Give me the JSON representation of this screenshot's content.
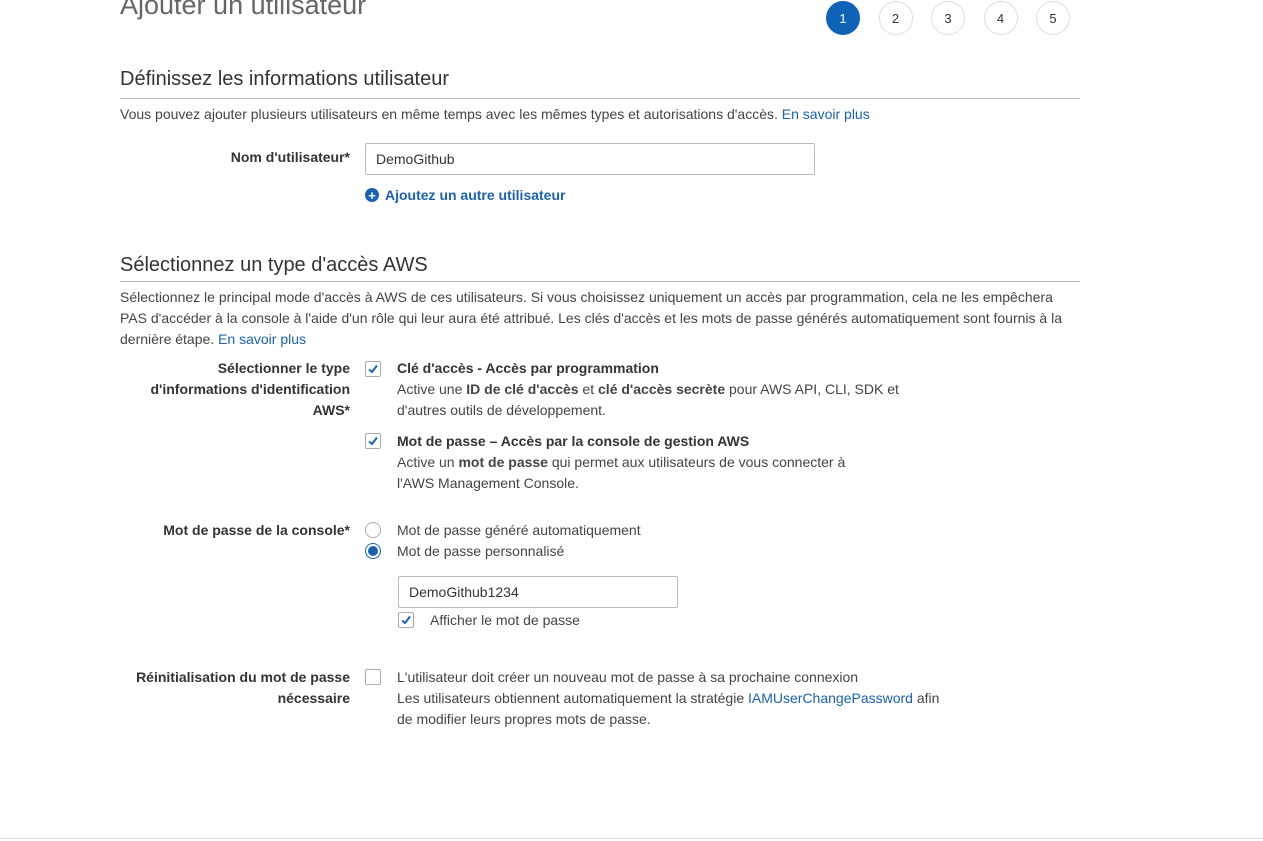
{
  "page": {
    "title": "Ajouter un utilisateur",
    "steps": [
      "1",
      "2",
      "3",
      "4",
      "5"
    ],
    "active_step": "1"
  },
  "user_info": {
    "heading": "Définissez les informations utilisateur",
    "description": "Vous pouvez ajouter plusieurs utilisateurs en même temps avec les mêmes types et autorisations d'accès.",
    "learn_more": "En savoir plus",
    "username_label": "Nom d'utilisateur*",
    "username_value": "DemoGithub",
    "add_user_link": "Ajoutez un autre utilisateur"
  },
  "access_type": {
    "heading": "Sélectionnez un type d'accès AWS",
    "description": "Sélectionnez le principal mode d'accès à AWS de ces utilisateurs. Si vous choisissez uniquement un accès par programmation, cela ne les empêchera PAS d'accéder à la console à l'aide d'un rôle qui leur aura été attribué. Les clés d'accès et les mots de passe générés automatiquement sont fournis à la dernière étape.",
    "learn_more": "En savoir plus",
    "select_label": "Sélectionner le type d'informations d'identification AWS*",
    "options": [
      {
        "title": "Clé d'accès - Accès par programmation",
        "text_pre": "Active une ",
        "bold1": "ID de clé d'accès",
        "text_mid": " et ",
        "bold2": "clé d'accès secrète",
        "text_post": " pour AWS API, CLI, SDK et d'autres outils de développement.",
        "checked": true
      },
      {
        "title": "Mot de passe – Accès par la console de gestion AWS",
        "text_pre": "Active un ",
        "bold1": "mot de passe",
        "text_post": " qui permet aux utilisateurs de vous connecter à l'AWS Management Console.",
        "checked": true
      }
    ]
  },
  "console_password": {
    "label": "Mot de passe de la console*",
    "options": [
      {
        "label": "Mot de passe généré automatiquement",
        "selected": false
      },
      {
        "label": "Mot de passe personnalisé",
        "selected": true
      }
    ],
    "password_value": "DemoGithub1234",
    "show_password_label": "Afficher le mot de passe",
    "show_password_checked": true
  },
  "password_reset": {
    "label": "Réinitialisation du mot de passe nécessaire",
    "checkbox_label": "L'utilisateur doit créer un nouveau mot de passe à sa prochaine connexion",
    "text_pre": "Les utilisateurs obtiennent automatiquement la stratégie ",
    "policy_link": "IAMUserChangePassword",
    "text_post": " afin de modifier leurs propres mots de passe.",
    "checked": false
  },
  "colors": {
    "accent": "#1a62b0",
    "active_step": "#0e63b8"
  }
}
